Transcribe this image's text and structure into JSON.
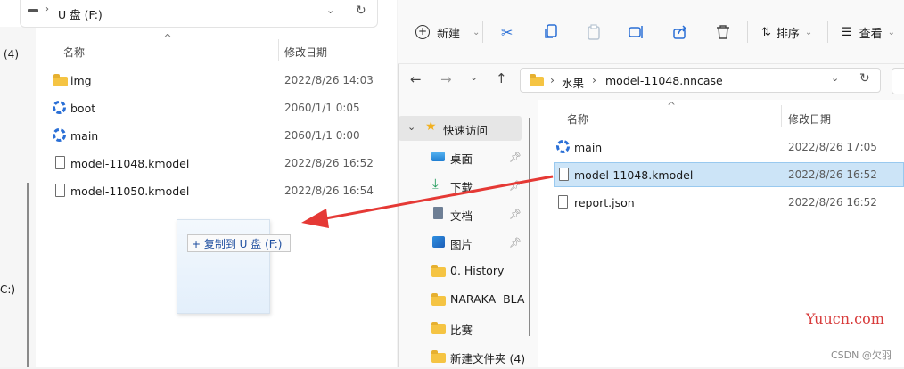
{
  "left_window": {
    "address": "U 盘 (F:)",
    "edge_label_top": "(4)",
    "edge_label_bottom": "C:)",
    "columns": {
      "name": "名称",
      "date": "修改日期"
    },
    "rows": [
      {
        "name": "img",
        "date": "2022/8/26 14:03",
        "icon": "folder-icon"
      },
      {
        "name": "boot",
        "date": "2060/1/1 0:05",
        "icon": "app-icon"
      },
      {
        "name": "main",
        "date": "2060/1/1 0:00",
        "icon": "app-icon"
      },
      {
        "name": "model-11048.kmodel",
        "date": "2022/8/26 16:52",
        "icon": "file-icon"
      },
      {
        "name": "model-11050.kmodel",
        "date": "2022/8/26 16:54",
        "icon": "file-icon"
      }
    ],
    "drag_tooltip": "+ 复制到 U 盘 (F:)"
  },
  "toolbar": {
    "new_label": "新建",
    "sort_label": "排序",
    "view_label": "查看"
  },
  "address_bar": {
    "crumbs": [
      "水果",
      "model-11048.nncase"
    ]
  },
  "nav_pane": {
    "quick_access": "快速访问",
    "items": [
      {
        "label": "桌面",
        "icon": "desktop-icon",
        "pinned": true
      },
      {
        "label": "下载",
        "icon": "download-icon",
        "pinned": true
      },
      {
        "label": "文档",
        "icon": "document-icon",
        "pinned": true
      },
      {
        "label": "图片",
        "icon": "picture-icon",
        "pinned": true
      },
      {
        "label": "0. History",
        "icon": "folder-icon",
        "pinned": false
      },
      {
        "label": "NARAKA  BLA",
        "icon": "folder-icon",
        "pinned": false
      },
      {
        "label": "比赛",
        "icon": "folder-icon",
        "pinned": false
      },
      {
        "label": "新建文件夹 (4)",
        "icon": "folder-icon",
        "pinned": false
      }
    ]
  },
  "right_content": {
    "columns": {
      "name": "名称",
      "date": "修改日期"
    },
    "rows": [
      {
        "name": "main",
        "date": "2022/8/26 17:05",
        "icon": "app-icon"
      },
      {
        "name": "model-11048.kmodel",
        "date": "2022/8/26 16:52",
        "icon": "file-icon",
        "selected": true
      },
      {
        "name": "report.json",
        "date": "2022/8/26 16:52",
        "icon": "file-icon"
      }
    ]
  },
  "watermarks": {
    "site": "Yuucn.com",
    "credit": "CSDN @欠羽"
  },
  "colors": {
    "selection": "#cce4f7",
    "arrow": "#e53935",
    "accent_blue": "#2a6fd6",
    "folder": "#f5c443"
  }
}
